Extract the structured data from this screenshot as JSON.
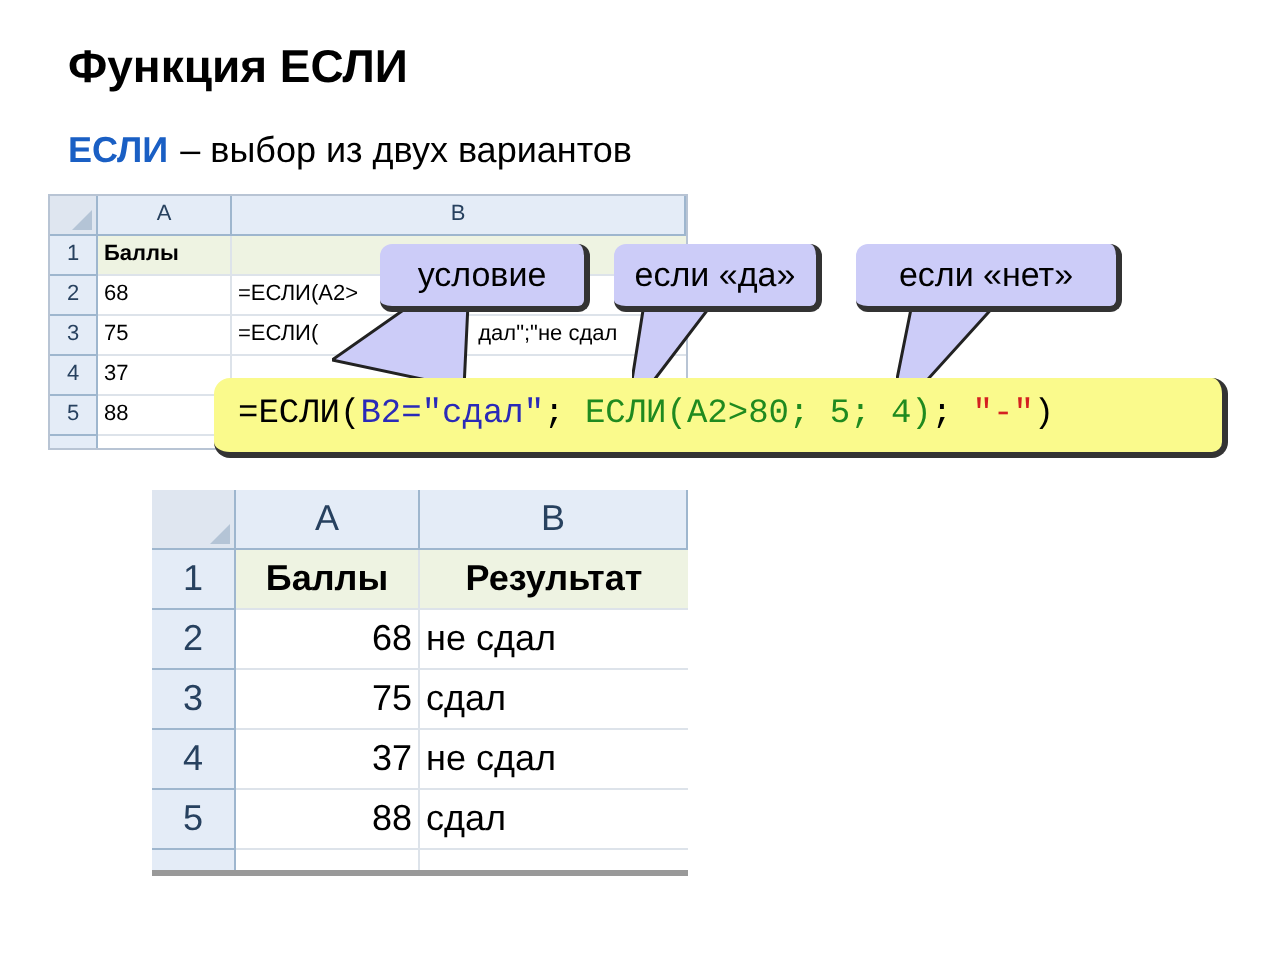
{
  "title": "Функция ЕСЛИ",
  "subtitle": {
    "keyword": "ЕСЛИ",
    "text": "– выбор из двух вариантов"
  },
  "top_sheet": {
    "columns": [
      "A",
      "B"
    ],
    "rows": [
      {
        "row": "1",
        "a": "Баллы",
        "b": []
      },
      {
        "row": "2",
        "a": "68",
        "b": [
          "=ЕСЛИ(А2>"
        ]
      },
      {
        "row": "3",
        "a": "75",
        "b": [
          "=ЕСЛИ(",
          "дал\";\"не сдал"
        ]
      },
      {
        "row": "4",
        "a": "37",
        "b": []
      },
      {
        "row": "5",
        "a": "88",
        "b": []
      }
    ]
  },
  "callouts": [
    "условие",
    "если «да»",
    "если «нет»"
  ],
  "formula": [
    {
      "text": "=ЕСЛИ(",
      "color": "#000000"
    },
    {
      "text": "B2=\"сдал\"",
      "color": "#2a2ab8"
    },
    {
      "text": "; ",
      "color": "#000000"
    },
    {
      "text": "ЕСЛИ(A2>80; 5; 4)",
      "color": "#1f8a1f"
    },
    {
      "text": "; ",
      "color": "#000000"
    },
    {
      "text": "\"-\"",
      "color": "#d42020"
    },
    {
      "text": ")",
      "color": "#000000"
    }
  ],
  "result_sheet": {
    "columns": [
      "A",
      "B"
    ],
    "rows": [
      {
        "row": "1",
        "a": "Баллы",
        "b": "Результат"
      },
      {
        "row": "2",
        "a": "68",
        "b": "не сдал"
      },
      {
        "row": "3",
        "a": "75",
        "b": "сдал"
      },
      {
        "row": "4",
        "a": "37",
        "b": "не сдал"
      },
      {
        "row": "5",
        "a": "88",
        "b": "сдал"
      }
    ]
  }
}
